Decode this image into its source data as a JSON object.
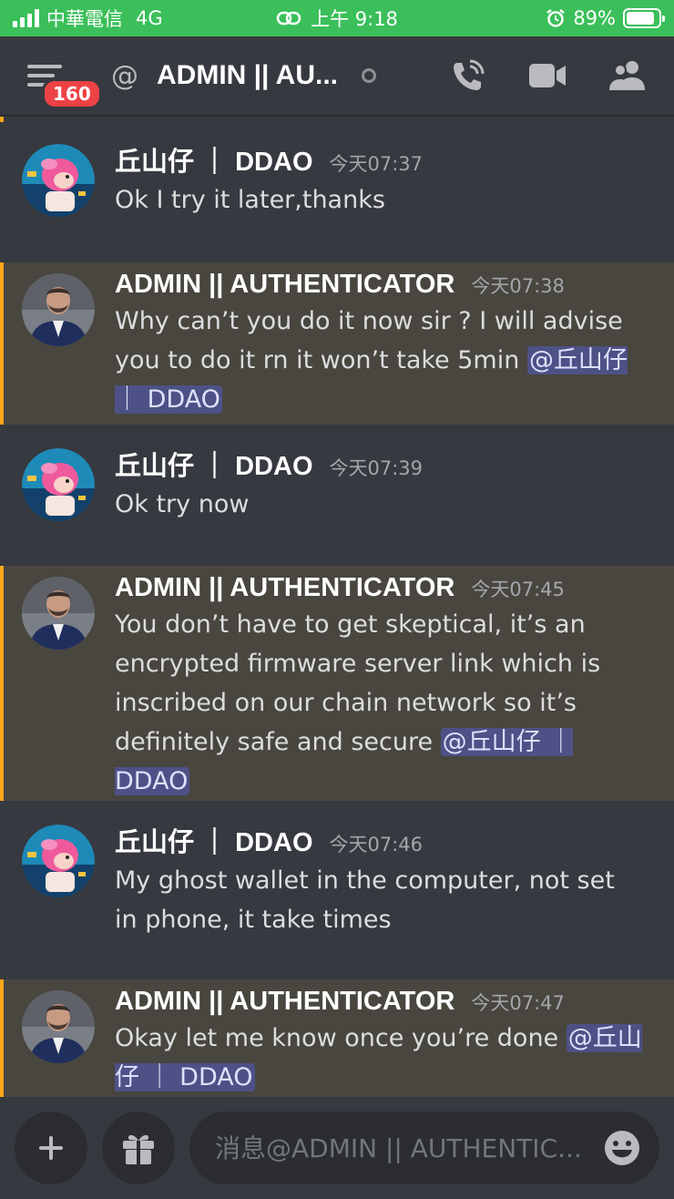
{
  "status_bar": {
    "carrier": "中華電信",
    "network": "4G",
    "time": "上午 9:18",
    "battery": "89%",
    "battery_level": 0.89
  },
  "header": {
    "unread_badge": "160",
    "at_symbol": "@",
    "channel_title": "ADMIN || AU...",
    "icons": [
      "menu-icon",
      "at-icon",
      "status-dot",
      "phone-call-icon",
      "video-camera-icon",
      "members-icon"
    ]
  },
  "messages": [
    {
      "author": "丘山仔 ｜ DDAO",
      "time": "今天07:37",
      "text": "Ok I try it later,thanks",
      "mention": "",
      "highlight": false
    },
    {
      "author": "ADMIN || AUTHENTICATOR",
      "time": "今天07:38",
      "text": "Why can’t you do it now sir ? I will advise you to do it rn it won’t take 5min ",
      "mention": "@丘山仔 ｜ DDAO",
      "highlight": true
    },
    {
      "author": "丘山仔 ｜ DDAO",
      "time": "今天07:39",
      "text": "Ok try now",
      "mention": "",
      "highlight": false
    },
    {
      "author": "ADMIN || AUTHENTICATOR",
      "time": "今天07:45",
      "text": "You don’t have to get skeptical, it’s an encrypted firmware server link which is inscribed on our chain network so it’s definitely safe and secure ",
      "mention": "@丘山仔 ｜ DDAO",
      "highlight": true
    },
    {
      "author": "丘山仔 ｜ DDAO",
      "time": "今天07:46",
      "text": "My ghost wallet in the computer, not set in phone, it take times",
      "mention": "",
      "highlight": false
    },
    {
      "author": "ADMIN || AUTHENTICATOR",
      "time": "今天07:47",
      "text": "Okay let me know once you’re done ",
      "mention": "@丘山仔 ｜ DDAO",
      "highlight": true
    }
  ],
  "composer": {
    "placeholder": "消息@ADMIN || AUTHENTIC...",
    "icons": [
      "plus-icon",
      "gift-icon",
      "emoji-icon"
    ]
  },
  "colors": {
    "background": "#36393f",
    "highlight_bg": "#48463f",
    "highlight_border": "#faa61a",
    "mention_bg": "#4e5186",
    "status_bar": "#3bbf5a",
    "badge": "#ed4245"
  }
}
